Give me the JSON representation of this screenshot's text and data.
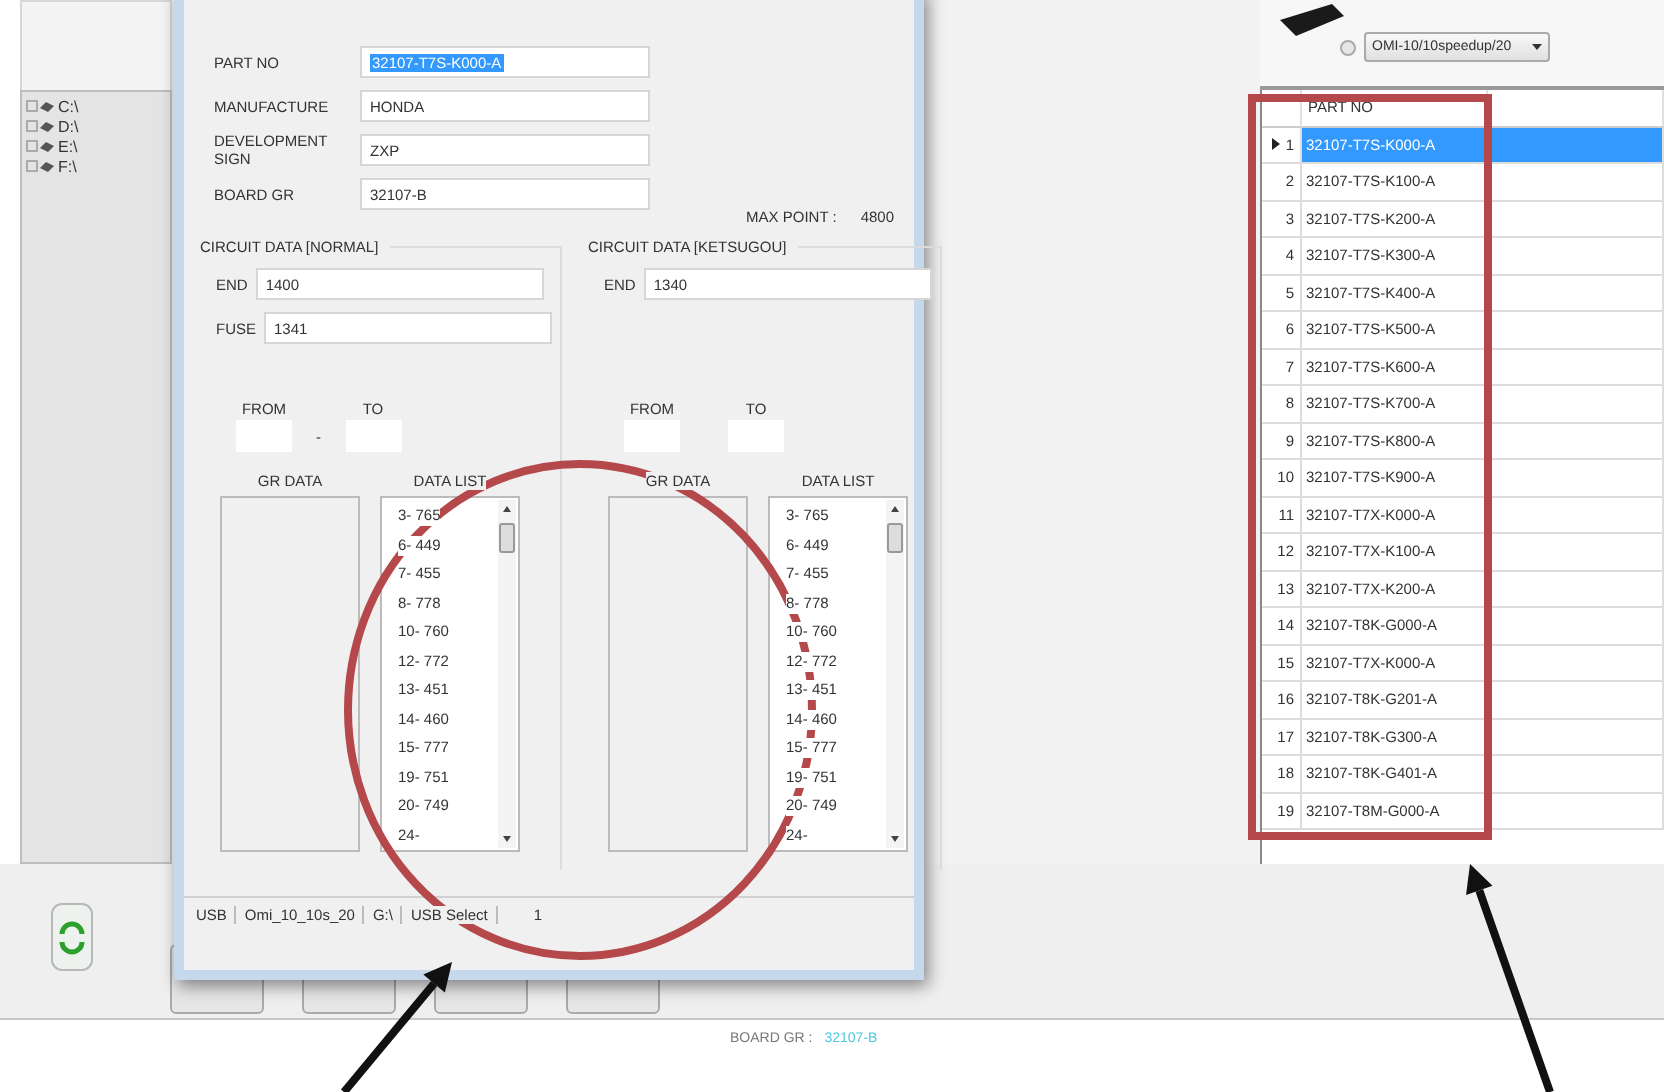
{
  "explorer": {
    "drives": [
      {
        "label": "C:\\"
      },
      {
        "label": "D:\\"
      },
      {
        "label": "E:\\"
      },
      {
        "label": "F:\\"
      }
    ]
  },
  "source": {
    "combo_value": "OMI-10/10speedup/20"
  },
  "table": {
    "columns": [
      "PART NO"
    ],
    "rows": [
      {
        "number": "1",
        "part_no": "32107-T7S-K000-A",
        "selected": true
      },
      {
        "number": "2",
        "part_no": "32107-T7S-K100-A",
        "selected": false
      },
      {
        "number": "3",
        "part_no": "32107-T7S-K200-A",
        "selected": false
      },
      {
        "number": "4",
        "part_no": "32107-T7S-K300-A",
        "selected": false
      },
      {
        "number": "5",
        "part_no": "32107-T7S-K400-A",
        "selected": false
      },
      {
        "number": "6",
        "part_no": "32107-T7S-K500-A",
        "selected": false
      },
      {
        "number": "7",
        "part_no": "32107-T7S-K600-A",
        "selected": false
      },
      {
        "number": "8",
        "part_no": "32107-T7S-K700-A",
        "selected": false
      },
      {
        "number": "9",
        "part_no": "32107-T7S-K800-A",
        "selected": false
      },
      {
        "number": "10",
        "part_no": "32107-T7S-K900-A",
        "selected": false
      },
      {
        "number": "11",
        "part_no": "32107-T7X-K000-A",
        "selected": false
      },
      {
        "number": "12",
        "part_no": "32107-T7X-K100-A",
        "selected": false
      },
      {
        "number": "13",
        "part_no": "32107-T7X-K200-A",
        "selected": false
      },
      {
        "number": "14",
        "part_no": "32107-T8K-G000-A",
        "selected": false
      },
      {
        "number": "15",
        "part_no": "32107-T7X-K000-A",
        "selected": false
      },
      {
        "number": "16",
        "part_no": "32107-T8K-G201-A",
        "selected": false
      },
      {
        "number": "17",
        "part_no": "32107-T8K-G300-A",
        "selected": false
      },
      {
        "number": "18",
        "part_no": "32107-T8K-G401-A",
        "selected": false
      },
      {
        "number": "19",
        "part_no": "32107-T8M-G000-A",
        "selected": false
      }
    ]
  },
  "bottom_bar": {
    "board_gr_label": "BOARD GR :",
    "board_gr_value": "32107-B"
  },
  "dialog": {
    "fields": [
      {
        "label": "PART NO",
        "value": "32107-T7S-K000-A",
        "selected": true
      },
      {
        "label": "MANUFACTURE",
        "value": "HONDA",
        "selected": false
      },
      {
        "label": "DEVELOPMENT SIGN",
        "value": "ZXP",
        "selected": false
      },
      {
        "label": "BOARD GR",
        "value": "32107-B",
        "selected": false
      }
    ],
    "max_point": {
      "label": "MAX POINT :",
      "value": "4800"
    },
    "groups": [
      {
        "title": "CIRCUIT DATA [NORMAL]",
        "inputs": [
          {
            "label": "END",
            "value": "1400"
          },
          {
            "label": "FUSE",
            "value": "1341"
          }
        ],
        "from_label": "FROM",
        "to_label": "TO",
        "separator": "-",
        "gr_data_label": "GR DATA",
        "data_list_label": "DATA LIST",
        "data_list": [
          "3- 765",
          "6- 449",
          "7- 455",
          "8- 778",
          "10- 760",
          "12- 772",
          "13- 451",
          "14- 460",
          "15- 777",
          "19- 751",
          "20- 749",
          "24-"
        ]
      },
      {
        "title": "CIRCUIT DATA [KETSUGOU]",
        "inputs": [
          {
            "label": "END",
            "value": "1340"
          }
        ],
        "from_label": "FROM",
        "to_label": "TO",
        "gr_data_label": "GR DATA",
        "data_list_label": "DATA LIST",
        "data_list": [
          "3- 765",
          "6- 449",
          "7- 455",
          "8- 778",
          "10- 760",
          "12- 772",
          "13- 451",
          "14- 460",
          "15- 777",
          "19- 751",
          "20- 749",
          "24-"
        ]
      }
    ],
    "status_bar": [
      "USB",
      "Omi_10_10s_20",
      "G:\\",
      "USB Select",
      "1"
    ]
  },
  "annotations": [
    {
      "kind": "ellipse"
    },
    {
      "kind": "rectangle"
    },
    {
      "kind": "arrow"
    },
    {
      "kind": "arrow"
    }
  ]
}
